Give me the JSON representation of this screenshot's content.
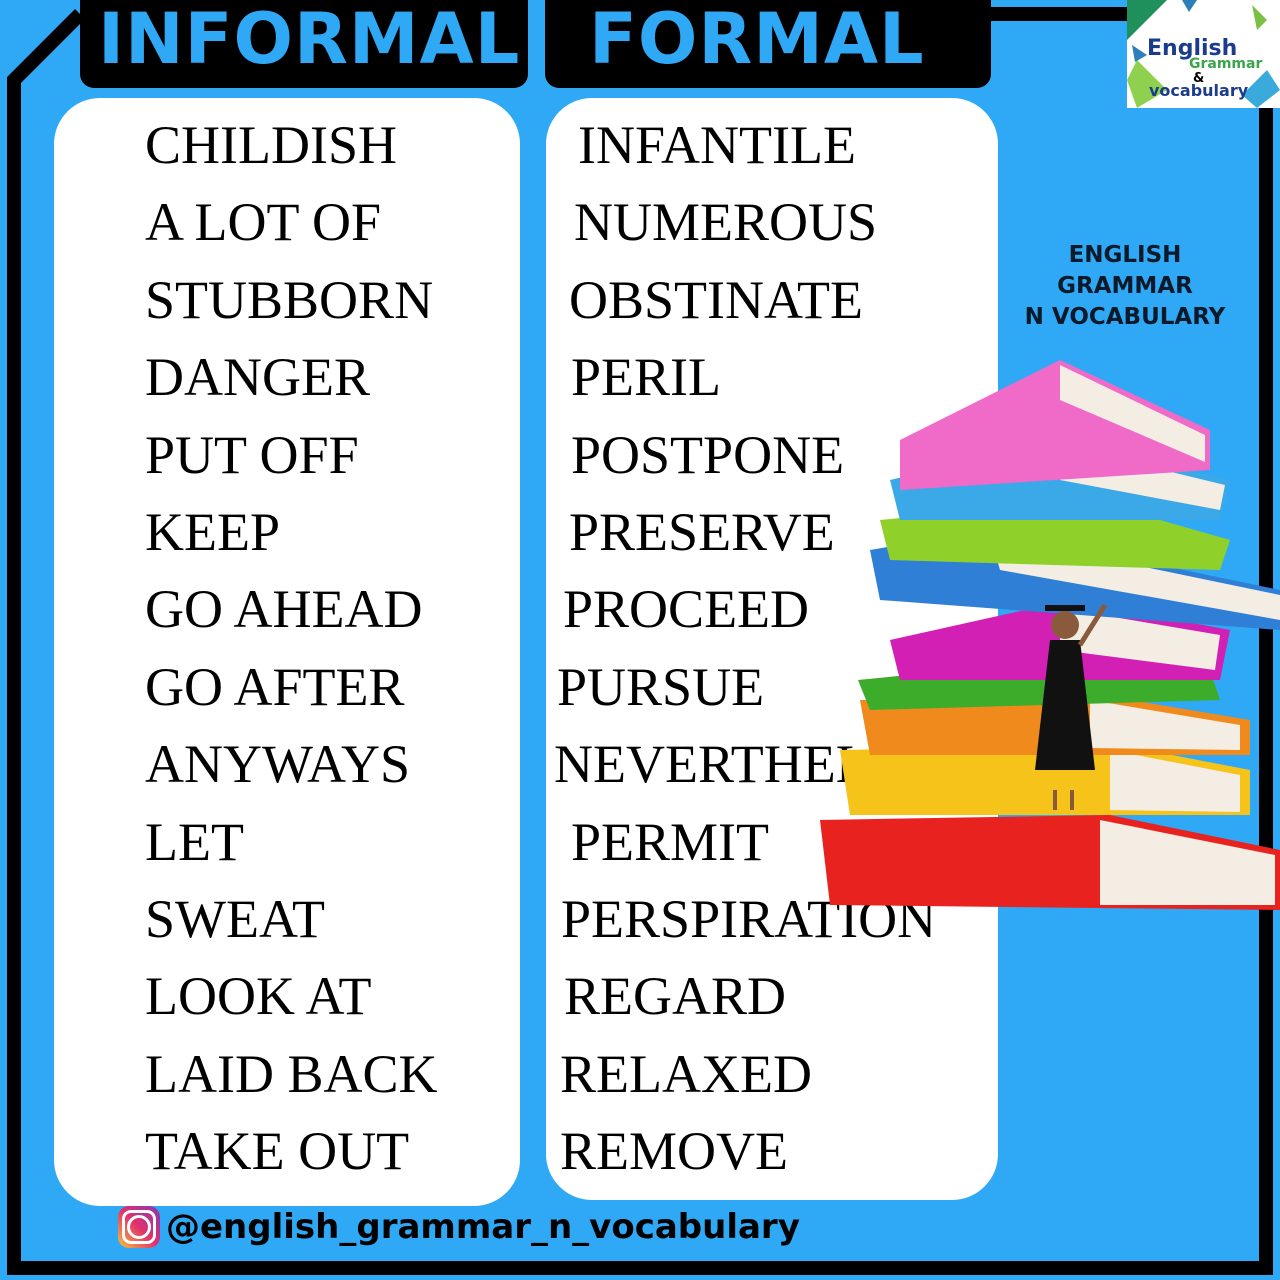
{
  "header": {
    "informal": "INFORMAL",
    "formal": "FORMAL"
  },
  "logo": {
    "line1": "English",
    "line2": "Grammar",
    "amp": "&",
    "line3": "vocabulary"
  },
  "informal_words": [
    "CHILDISH",
    "A LOT OF",
    "STUBBORN",
    "DANGER",
    "PUT OFF",
    "KEEP",
    "GO AHEAD",
    "GO AFTER",
    "ANYWAYS",
    "LET",
    "SWEAT",
    "LOOK AT",
    "LAID BACK",
    "TAKE OUT"
  ],
  "formal_words": [
    "INFANTILE",
    "NUMEROUS",
    "OBSTINATE",
    "PERIL",
    "POSTPONE",
    "PRESERVE",
    "PROCEED",
    "PURSUE",
    "NEVERTHELESS",
    "PERMIT",
    "PERSPIRATION",
    "REGARD",
    "RELAXED",
    "REMOVE"
  ],
  "side": {
    "line1": "ENGLISH GRAMMAR",
    "line2": "N VOCABULARY"
  },
  "footer": {
    "handle": "@english_grammar_n_vocabulary"
  },
  "colors": {
    "background": "#2fa9f5",
    "frame": "#000000",
    "panel": "#ffffff"
  }
}
